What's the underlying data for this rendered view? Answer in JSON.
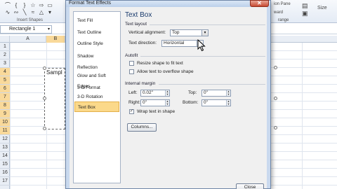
{
  "ribbon": {
    "insert_shapes_label": "Insert Shapes",
    "right_labels": [
      "ward",
      "ion Pane",
      "range",
      "Size"
    ]
  },
  "formula_bar": {
    "name_box": "Rectangle 1"
  },
  "columns": [
    "A",
    "B"
  ],
  "rows": [
    "1",
    "2",
    "3",
    "4",
    "5",
    "6",
    "7",
    "8",
    "9",
    "10",
    "11",
    "12",
    "13",
    "14",
    "15",
    "16",
    "17"
  ],
  "shape": {
    "text": "Sampl"
  },
  "dialog": {
    "title": "Format Text Effects",
    "close": "✕",
    "nav": [
      "Text Fill",
      "Text Outline",
      "Outline Style",
      "Shadow",
      "Reflection",
      "Glow and Soft Edges",
      "3-D Format",
      "3-D Rotation",
      "Text Box"
    ],
    "selected_nav": "Text Box",
    "panel_title": "Text Box",
    "text_layout": {
      "label": "Text layout",
      "vertical_alignment_label": "Vertical alignment:",
      "vertical_alignment_value": "Top",
      "text_direction_label": "Text direction:",
      "text_direction_value": "Horizontal"
    },
    "autofit": {
      "label": "Autofit",
      "resize_label": "Resize shape to fit text",
      "overflow_label": "Allow text to overflow shape"
    },
    "internal_margin": {
      "label": "Internal margin",
      "left_label": "Left:",
      "left_value": "0.02\"",
      "top_label": "Top:",
      "top_value": "0\"",
      "right_label": "Right:",
      "right_value": "0\"",
      "bottom_label": "Bottom:",
      "bottom_value": "0\"",
      "wrap_label": "Wrap text in shape",
      "wrap_checked": "✓"
    },
    "columns_button": "Columns...",
    "close_button": "Close"
  }
}
